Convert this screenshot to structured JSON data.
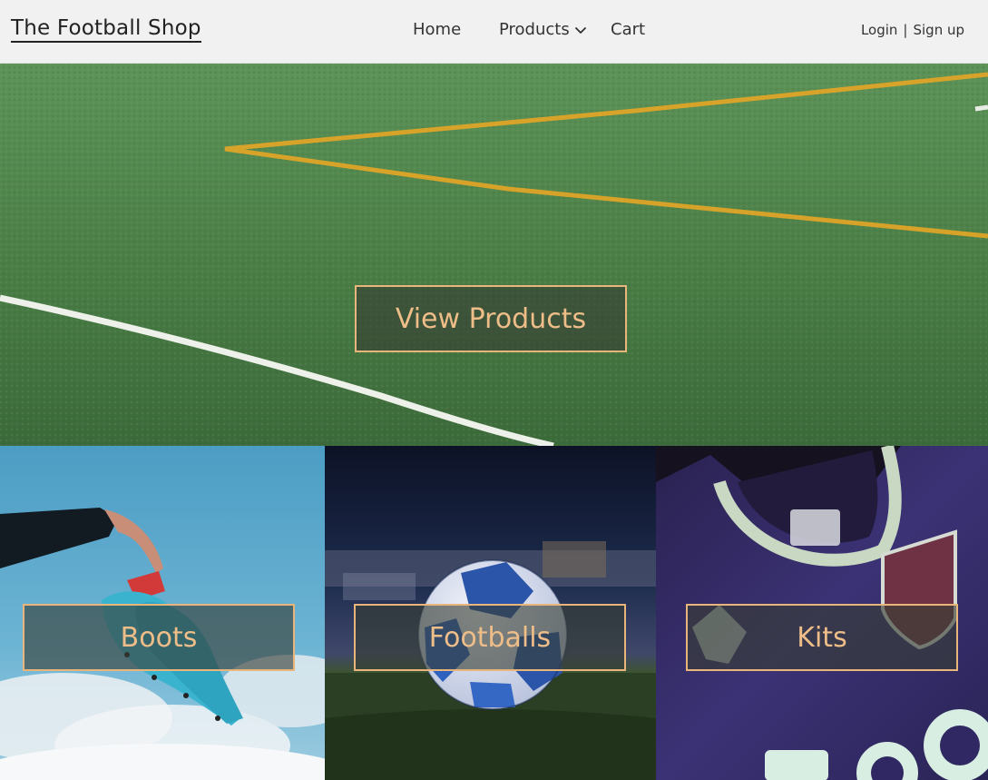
{
  "navbar": {
    "brand": "The Football Shop",
    "links": {
      "home": "Home",
      "products": "Products",
      "cart": "Cart"
    },
    "auth": {
      "login": "Login",
      "separator": "|",
      "signup": "Sign up"
    }
  },
  "hero": {
    "cta_label": "View Products"
  },
  "categories": [
    {
      "label": "Boots"
    },
    {
      "label": "Footballs"
    },
    {
      "label": "Kits"
    }
  ],
  "colors": {
    "accent": "#e9b57a",
    "navbar_bg": "#f1f1f1",
    "pitch_green": "#4a7d46"
  },
  "icons": {
    "products_dropdown": "chevron-down-icon"
  }
}
